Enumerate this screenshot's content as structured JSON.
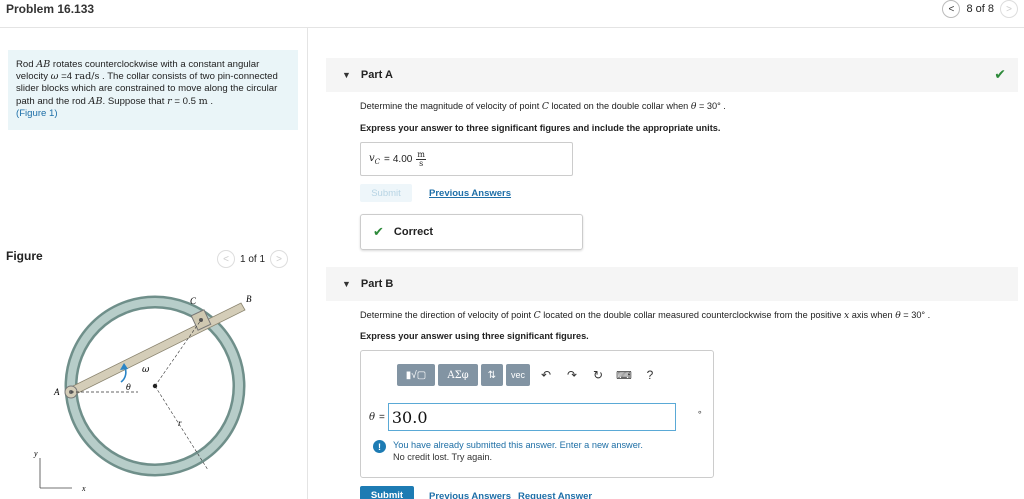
{
  "header": {
    "title": "Problem 16.133",
    "position": "8 of 8"
  },
  "problem": {
    "t1": "Rod ",
    "ab": "AB",
    "t2": " rotates counterclockwise with a constant angular velocity ",
    "omega": "ω",
    "t3": " =4 ",
    "unit": "rad/s",
    "t4": " . The collar consists of two pin-connected slider blocks which are constrained to move along the circular path and the rod ",
    "ab2": "AB",
    "t5": ". Suppose that ",
    "r": "r",
    "t6": " = 0.5 ",
    "m": "m",
    "t7": " .",
    "figure_link": "(Figure 1)"
  },
  "figure": {
    "label": "Figure",
    "position": "1 of 1",
    "labels": {
      "A": "A",
      "B": "B",
      "C": "C",
      "omega": "ω",
      "theta": "θ",
      "r": "r",
      "y": "y",
      "x": "x"
    }
  },
  "partA": {
    "title": "Part A",
    "q_pre": "Determine the magnitude of velocity of point ",
    "q_c": "C",
    "q_post": " located on the double collar when ",
    "q_theta": "θ",
    "q_end": " = 30° .",
    "instruction": "Express your answer to three significant figures and include the appropriate units.",
    "answer_label": "v",
    "answer_sub": "C",
    "answer_eq": " = ",
    "answer_value": "4.00",
    "unit_num": "m",
    "unit_den": "s",
    "submit": "Submit",
    "previous": "Previous Answers",
    "correct": "Correct"
  },
  "partB": {
    "title": "Part B",
    "q_pre": "Determine the direction of velocity of point ",
    "q_c": "C",
    "q_mid": " located on the double collar measured counterclockwise from the positive ",
    "q_x": "x",
    "q_mid2": " axis when ",
    "q_theta": "θ",
    "q_end": " = 30° .",
    "instruction": "Express your answer using three significant figures.",
    "toolbar": {
      "templates": "▮√▢",
      "greek": "ΑΣφ",
      "sort": "⇅",
      "vec": "vec",
      "undo": "↶",
      "redo": "↷",
      "reset": "↻",
      "keyboard": "⌨",
      "help": "?"
    },
    "theta_label": "θ",
    "theta_eq": " = ",
    "answer_value": "30.0",
    "degree": "∘",
    "warn1": "You have already submitted this answer. Enter a new answer.",
    "warn2": "No credit lost. Try again.",
    "submit": "Submit",
    "previous": "Previous Answers",
    "request": "Request Answer"
  },
  "colors": {
    "accent": "#1d7bb3",
    "correct": "#2d8a3a",
    "problem_bg": "#eaf5f8",
    "ring": "#8faea8"
  }
}
